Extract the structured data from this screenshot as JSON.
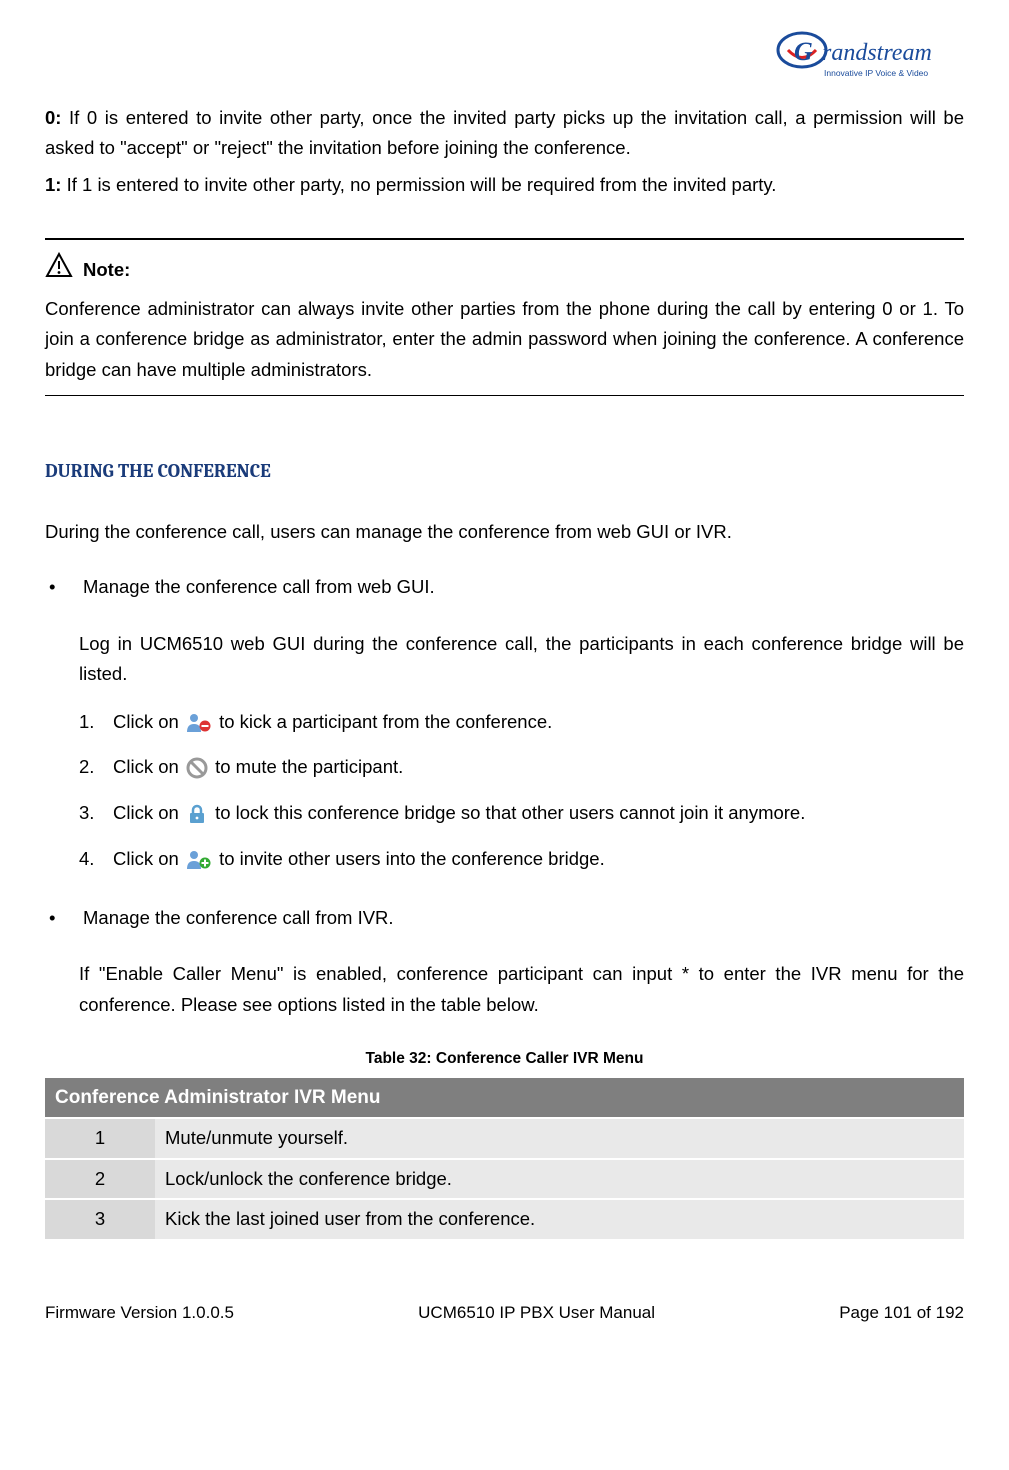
{
  "logo": {
    "name": "Grandstream",
    "tagline": "Innovative IP Voice & Video"
  },
  "intro": {
    "opt0_label": "0:",
    "opt0_text": " If 0 is entered to invite other party, once the invited party picks up the invitation call, a permission will be asked to \"accept\" or \"reject\" the invitation before joining the conference.",
    "opt1_label": "1:",
    "opt1_text": " If 1 is entered to invite other party, no permission will be required from the invited party."
  },
  "note": {
    "label": "Note:",
    "body": "Conference administrator can always invite other parties from the phone during the call by entering 0 or 1. To join a conference bridge as administrator, enter the admin password when joining the conference. A conference bridge can have multiple administrators."
  },
  "section_title": "DURING THE CONFERENCE",
  "section_intro": "During the conference call, users can manage the conference from web GUI or IVR.",
  "bullets": {
    "b1": "Manage the conference call from web GUI.",
    "b1_sub": "Log in UCM6510 web GUI during the conference call, the participants in each conference bridge will be listed.",
    "steps": {
      "s1a": "Click on ",
      "s1b": " to kick a participant from the conference.",
      "s2a": "Click on ",
      "s2b": " to mute the participant.",
      "s3a": "Click on ",
      "s3b": " to lock this conference bridge so that other users cannot join it anymore.",
      "s4a": "Click on ",
      "s4b": " to invite other users into the conference bridge."
    },
    "b2": "Manage the conference call from IVR.",
    "b2_sub": "If \"Enable Caller Menu\" is enabled, conference participant can input * to enter the IVR menu for the conference. Please see options listed in the table below."
  },
  "table": {
    "caption": "Table 32: Conference Caller IVR Menu",
    "header": "Conference Administrator IVR Menu",
    "rows": [
      {
        "k": "1",
        "d": "Mute/unmute yourself."
      },
      {
        "k": "2",
        "d": "Lock/unlock the conference bridge."
      },
      {
        "k": "3",
        "d": "Kick the last joined user from the conference."
      }
    ]
  },
  "footer": {
    "left": "Firmware Version 1.0.0.5",
    "center": "UCM6510 IP PBX User Manual",
    "right": "Page 101 of 192"
  }
}
